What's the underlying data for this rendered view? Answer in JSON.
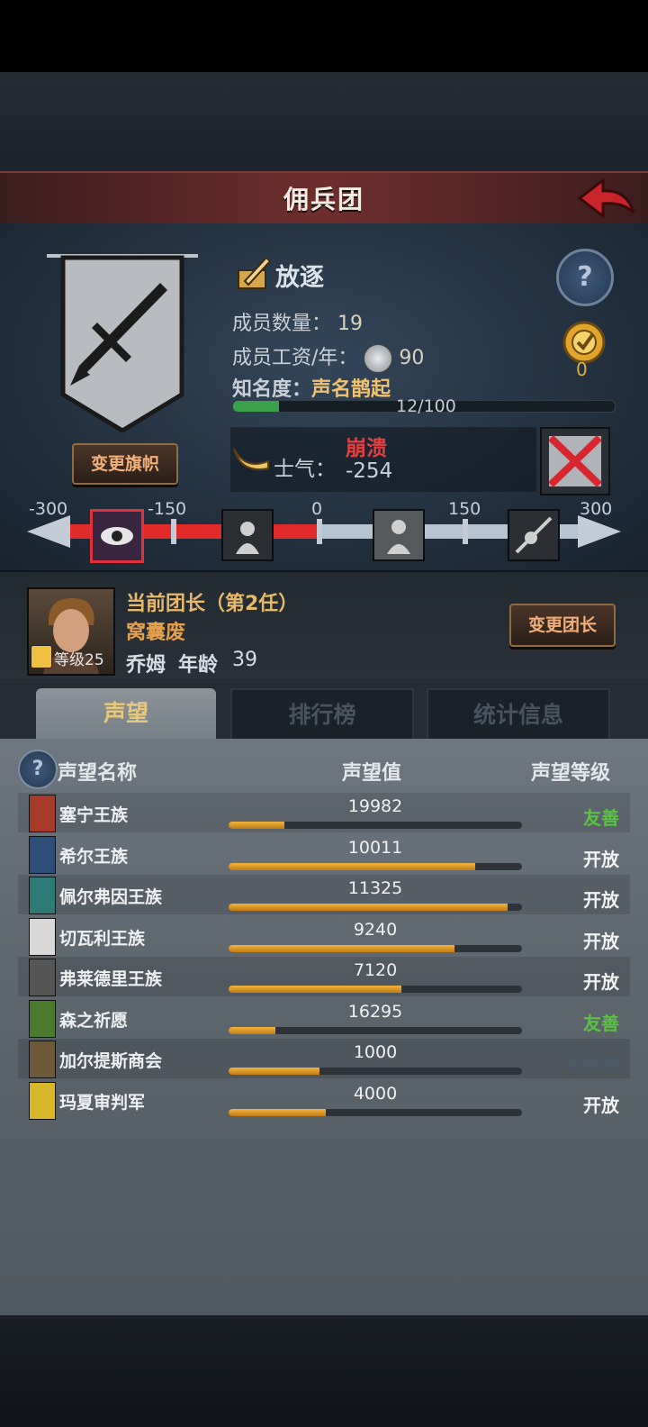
{
  "header": {
    "title": "佣兵团"
  },
  "company": {
    "state": "放逐",
    "members_label": "成员数量：",
    "members": "19",
    "wage_label": "成员工资/年：",
    "wage": "90",
    "fame_label": "知名度：",
    "fame_value": "声名鹊起",
    "fame_progress": "12/100",
    "fame_fraction": 0.12,
    "change_flag": "变更旗帜",
    "medal_count": "0",
    "morale_label": "士气：",
    "morale_state": "崩溃",
    "morale_value": "-254"
  },
  "morale_scale": {
    "ticks": [
      "-300",
      "-150",
      "0",
      "150",
      "300"
    ],
    "levels": [
      {
        "icon": "eye-icon",
        "active": true
      },
      {
        "icon": "despair-icon",
        "active": false
      },
      {
        "icon": "calm-figure-icon",
        "active": false
      },
      {
        "icon": "charge-icon",
        "active": false
      }
    ]
  },
  "captain": {
    "title": "当前团长（第2任）",
    "trait": "窝囊废",
    "name": "乔姆",
    "age_label": "年龄",
    "age": "39",
    "level_label": "等级25",
    "change_button": "变更团长"
  },
  "tabs": [
    "声望",
    "排行榜",
    "统计信息"
  ],
  "reputation": {
    "headers": [
      "声望名称",
      "声望值",
      "声望等级"
    ],
    "rows": [
      {
        "name": "塞宁王族",
        "value": "19982",
        "fill": 0.19,
        "level": "友善",
        "level_color": "#5bc142",
        "crest": "#a83a2a"
      },
      {
        "name": "希尔王族",
        "value": "10011",
        "fill": 0.84,
        "level": "开放",
        "level_color": "#f2f2f2",
        "crest": "#2e4e7a"
      },
      {
        "name": "佩尔弗因王族",
        "value": "11325",
        "fill": 0.95,
        "level": "开放",
        "level_color": "#f2f2f2",
        "crest": "#2e7a76"
      },
      {
        "name": "切瓦利王族",
        "value": "9240",
        "fill": 0.77,
        "level": "开放",
        "level_color": "#f2f2f2",
        "crest": "#d9d9d9"
      },
      {
        "name": "弗莱德里王族",
        "value": "7120",
        "fill": 0.59,
        "level": "开放",
        "level_color": "#f2f2f2",
        "crest": "#555555"
      },
      {
        "name": "森之祈愿",
        "value": "16295",
        "fill": 0.16,
        "level": "友善",
        "level_color": "#5bc142",
        "crest": "#4a7a2c"
      },
      {
        "name": "加尔提斯商会",
        "value": "1000",
        "fill": 0.31,
        "level": "非开放",
        "level_color": "#4a5a68",
        "crest": "#6e5a3a"
      },
      {
        "name": "玛夏审判军",
        "value": "4000",
        "fill": 0.33,
        "level": "开放",
        "level_color": "#f2f2f2",
        "crest": "#d8b82a"
      }
    ]
  }
}
